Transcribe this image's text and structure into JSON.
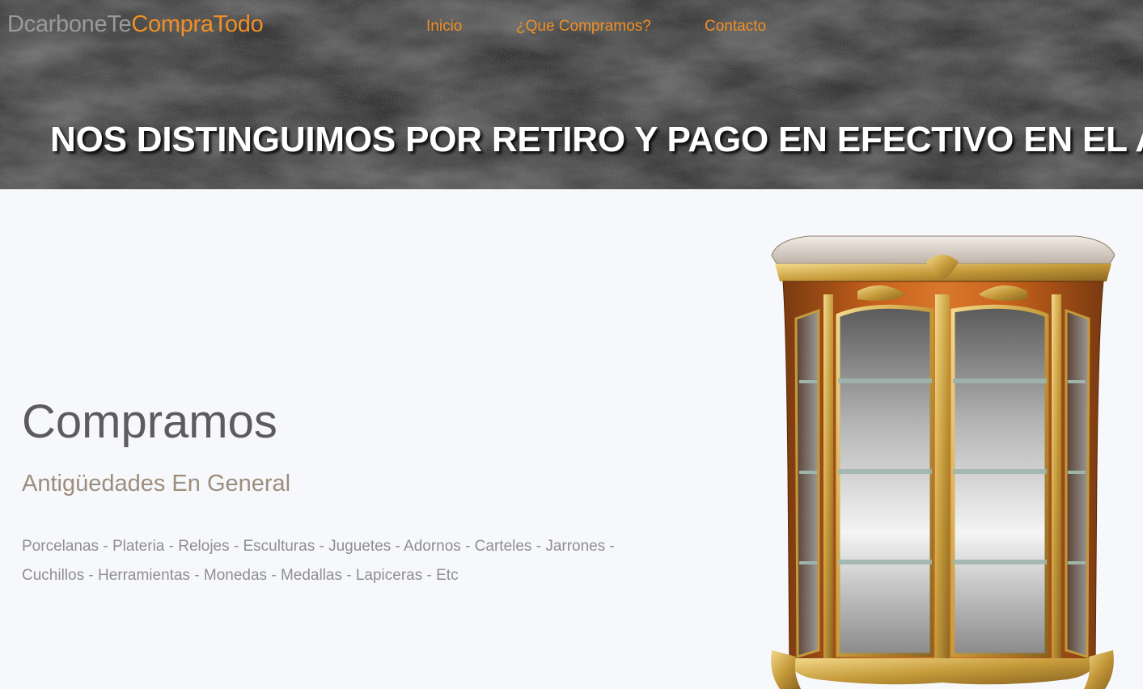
{
  "header": {
    "brand_part1": "DcarboneTe",
    "brand_part2": "CompraTodo",
    "nav": [
      {
        "label": "Inicio"
      },
      {
        "label": "¿Que Compramos?"
      },
      {
        "label": "Contacto"
      }
    ],
    "banner": "NOS DISTINGUIMOS POR RETIRO Y PAGO EN EFECTIVO EN EL ACTO."
  },
  "main": {
    "title": "Compramos",
    "subtitle": "Antigüedades En General",
    "items_line1": "Porcelanas - Plateria - Relojes - Esculturas - Juguetes - Adornos - Carteles - Jarrones -",
    "items_line2": "Cuchillos - Herramientas - Monedas - Medallas - Lapiceras - Etc"
  },
  "colors": {
    "accent": "#f28f24",
    "background": "#f7f8fc",
    "hero_dark": "#202020"
  },
  "image": {
    "subject": "antique-display-cabinet"
  }
}
